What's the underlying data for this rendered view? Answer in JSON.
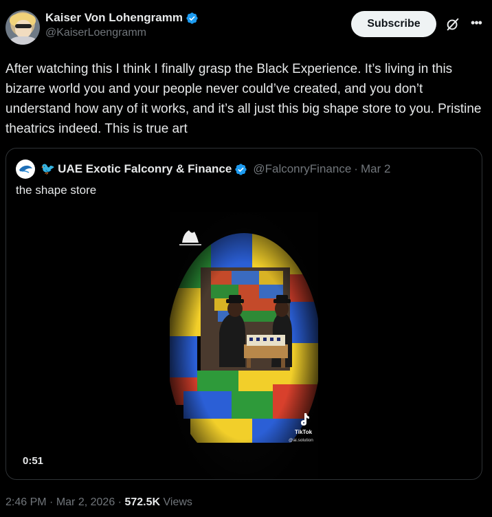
{
  "author": {
    "display_name": "Kaiser Von Lohengramm",
    "handle": "@KaiserLoengramm",
    "verified": true,
    "verified_color": "#1d9bf0"
  },
  "actions": {
    "subscribe_label": "Subscribe",
    "grok_icon": "grok-icon",
    "more_icon": "more-horizontal-icon"
  },
  "tweet": {
    "text": "After watching this I think I finally grasp the Black Experience. It’s living in this bizarre world you and your people never could’ve created, and you don’t understand how any of it works, and it’s all just this big shape store to you. Pristine theatrics indeed. This is true art"
  },
  "quote": {
    "avatar_icon": "falcon-logo-icon",
    "name_emoji": "🐦",
    "display_name": "UAE Exotic Falconry & Finance",
    "verified": true,
    "handle": "@FalconryFinance",
    "separator": "·",
    "date": "Mar 2",
    "text": "the shape store",
    "video": {
      "duration": "0:51",
      "watermark": "TikTok",
      "watermark_user": "@ai.solution"
    }
  },
  "meta": {
    "time": "2:46 PM",
    "sep1": "·",
    "date": "Mar 2, 2026",
    "sep2": "·",
    "views_count": "572.5K",
    "views_label": "Views"
  },
  "colors": {
    "background": "#000000",
    "text_primary": "#e7e9ea",
    "text_secondary": "#71767b",
    "border": "#2f3336"
  }
}
